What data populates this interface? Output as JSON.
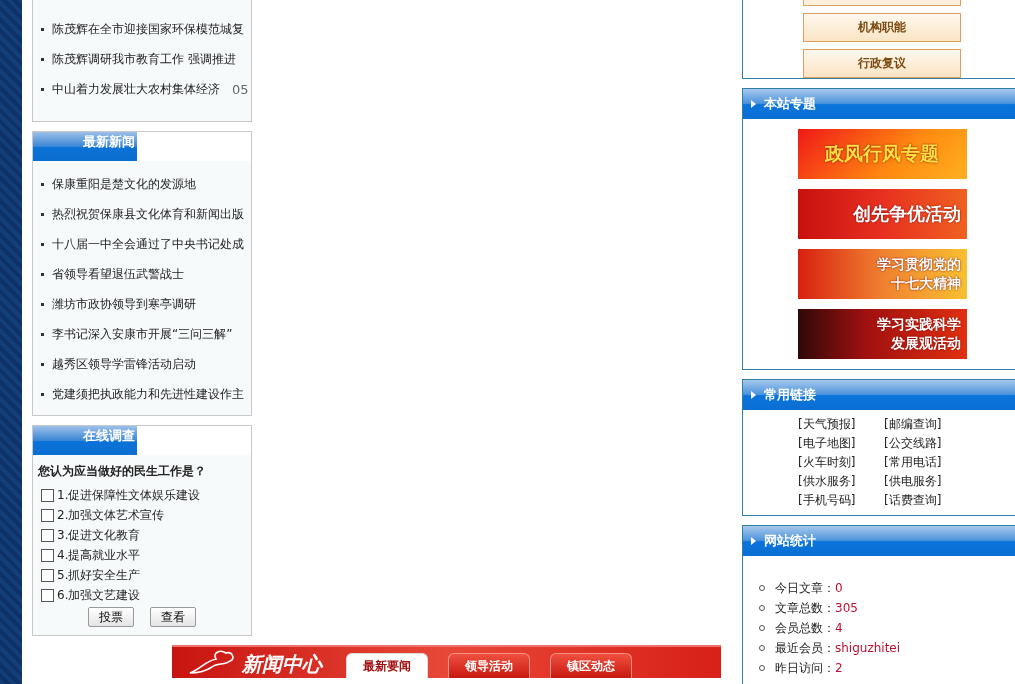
{
  "top_news": {
    "items": [
      {
        "title": "陈茂辉在全市迎接国家环保模范城复"
      },
      {
        "title": "陈茂辉调研我市教育工作 强调推进"
      },
      {
        "title": "中山着力发展壮大农村集体经济",
        "date": "05"
      }
    ]
  },
  "latest_news": {
    "title": "最新新闻",
    "items": [
      {
        "title": "保康重阳是楚文化的发源地"
      },
      {
        "title": "热烈祝贺保康县文化体育和新闻出版"
      },
      {
        "title": "十八届一中全会通过了中央书记处成"
      },
      {
        "title": "省领导看望退伍武警战士"
      },
      {
        "title": "潍坊市政协领导到寒亭调研"
      },
      {
        "title": "李书记深入安康市开展“三问三解”"
      },
      {
        "title": "越秀区领导学雷锋活动启动"
      },
      {
        "title": "党建须把执政能力和先进性建设作主"
      }
    ]
  },
  "survey": {
    "title": "在线调查",
    "question": "您认为应当做好的民生工作是？",
    "options": [
      {
        "label": "1.促进保障性文体娱乐建设",
        "checked": false
      },
      {
        "label": "2.加强文体艺术宣传",
        "checked": false
      },
      {
        "label": "3.促进文化教育",
        "checked": false
      },
      {
        "label": "4.提高就业水平",
        "checked": false
      },
      {
        "label": "5.抓好安全生产",
        "checked": false
      },
      {
        "label": "6.加强文艺建设",
        "checked": false
      }
    ],
    "buttons": [
      "投票",
      "查看"
    ]
  },
  "news_center": {
    "title": "新闻中心",
    "tabs": [
      {
        "label": "最新要闻",
        "selected": true
      },
      {
        "label": "领导活动",
        "selected": false
      },
      {
        "label": "镇区动态",
        "selected": false
      }
    ]
  },
  "info_buttons": [
    "机构职能",
    "行政复议"
  ],
  "topics": {
    "title": "本站专题",
    "banners": [
      {
        "lines": [
          "政风行风专题"
        ],
        "kind": "orange"
      },
      {
        "lines": [
          "创先争优活动"
        ],
        "kind": "red"
      },
      {
        "lines": [
          "学习贯彻党的",
          "十七大精神"
        ],
        "kind": "gold"
      },
      {
        "lines": [
          "学习实践科学",
          "发展观活动"
        ],
        "kind": "dark"
      }
    ]
  },
  "links": {
    "title": "常用链接",
    "items": [
      "[天气预报]",
      "[邮编查询]",
      "[电子地图]",
      "[公交线路]",
      "[火车时刻]",
      "[常用电话]",
      "[供水服务]",
      "[供电服务]",
      "[手机号码]",
      "[话费查询]"
    ]
  },
  "stats": {
    "title": "网站统计",
    "rows": [
      {
        "label": "今日文章：",
        "value": "0"
      },
      {
        "label": "文章总数：",
        "value": "305"
      },
      {
        "label": "会员总数：",
        "value": "4"
      },
      {
        "label": "最近会员：",
        "value": "shiguzhitei"
      },
      {
        "label": "昨日访问：",
        "value": "2"
      }
    ]
  }
}
